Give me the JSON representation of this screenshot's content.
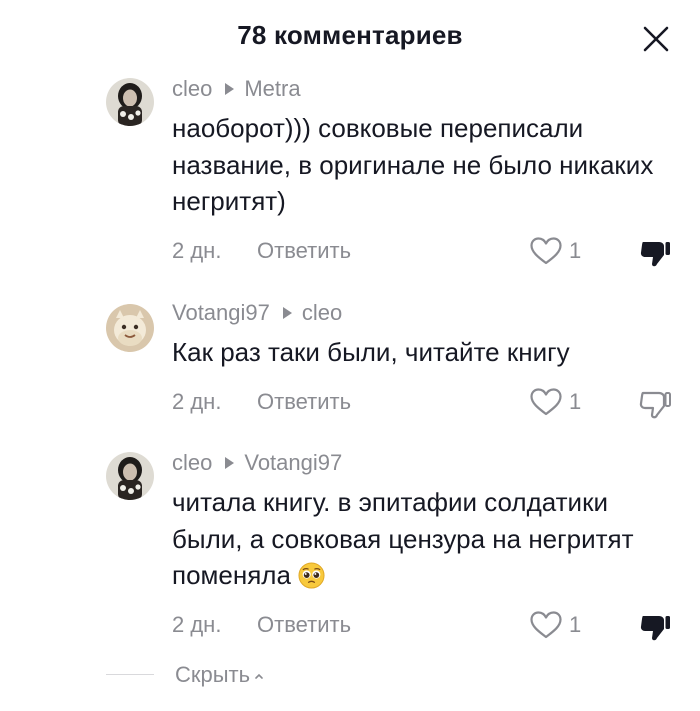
{
  "header": {
    "title": "78 комментариев"
  },
  "actions_labels": {
    "reply": "Ответить",
    "hide": "Скрыть"
  },
  "comments": [
    {
      "author": "cleo",
      "reply_to": "Metra",
      "text": "наоборот))) совковые переписали название, в оригинале не было никаких негритят)",
      "time": "2 дн.",
      "likes": "1",
      "disliked": true
    },
    {
      "author": "Votangi97",
      "reply_to": "cleo",
      "text": "Как раз таки были, читайте книгу",
      "time": "2 дн.",
      "likes": "1",
      "disliked": false
    },
    {
      "author": "cleo",
      "reply_to": "Votangi97",
      "text": "читала книгу. в эпитафии солдатики были, а совковая цензура на негритят поменяла",
      "emoji": "pleading-face",
      "time": "2 дн.",
      "likes": "1",
      "disliked": true
    }
  ],
  "colors": {
    "text": "#161823",
    "secondary": "#8a8b91",
    "background": "#ffffff"
  }
}
